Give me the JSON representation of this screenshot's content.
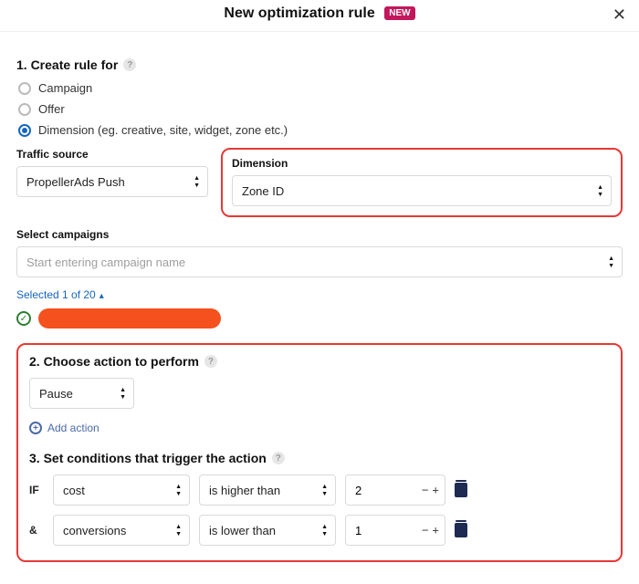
{
  "header": {
    "title": "New optimization rule",
    "badge": "NEW"
  },
  "section1": {
    "title": "1. Create rule for",
    "options": {
      "campaign": "Campaign",
      "offer": "Offer",
      "dimension": "Dimension (eg. creative, site, widget, zone etc.)"
    },
    "selected": "dimension",
    "traffic_label": "Traffic source",
    "traffic_value": "PropellerAds Push",
    "dimension_label": "Dimension",
    "dimension_value": "Zone ID",
    "campaigns_label": "Select campaigns",
    "campaigns_placeholder": "Start entering campaign name",
    "selected_count_text": "Selected 1 of 20"
  },
  "section2": {
    "title": "2. Choose action to perform",
    "action_value": "Pause",
    "add_action": "Add action"
  },
  "section3": {
    "title": "3. Set conditions that trigger the action",
    "rows": [
      {
        "prefix": "IF",
        "metric": "cost",
        "op": "is higher than",
        "value": "2"
      },
      {
        "prefix": "&",
        "metric": "conversions",
        "op": "is lower than",
        "value": "1"
      }
    ]
  }
}
